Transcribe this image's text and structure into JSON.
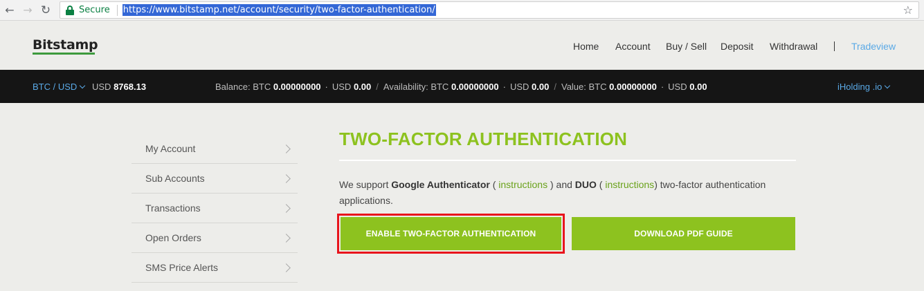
{
  "browser": {
    "secure_label": "Secure",
    "url": "https://www.bitstamp.net/account/security/two-factor-authentication/"
  },
  "header": {
    "logo": "Bitstamp",
    "nav": [
      "Home",
      "Account",
      "Buy / Sell",
      "Deposit",
      "Withdrawal"
    ],
    "tradeview": "Tradeview"
  },
  "ticker": {
    "pair": "BTC / USD",
    "price_currency": "USD",
    "price": "8768.13",
    "balance_label": "Balance:",
    "balance_btc_label": "BTC",
    "balance_btc": "0.00000000",
    "balance_usd_label": "USD",
    "balance_usd": "0.00",
    "availability_label": "Availability:",
    "availability_btc_label": "BTC",
    "availability_btc": "0.00000000",
    "availability_usd_label": "USD",
    "availability_usd": "0.00",
    "value_label": "Value:",
    "value_btc_label": "BTC",
    "value_btc": "0.00000000",
    "value_usd_label": "USD",
    "value_usd": "0.00",
    "account_name": "iHolding .io"
  },
  "sidebar": {
    "items": [
      {
        "label": "My Account"
      },
      {
        "label": "Sub Accounts"
      },
      {
        "label": "Transactions"
      },
      {
        "label": "Open Orders"
      },
      {
        "label": "SMS Price Alerts"
      }
    ]
  },
  "main": {
    "title": "TWO-FACTOR AUTHENTICATION",
    "desc_part1": "We support ",
    "google": "Google Authenticator",
    "desc_part2": " ( ",
    "instructions1": "instructions",
    "desc_part3": " ) and ",
    "duo": "DUO",
    "desc_part4": " ( ",
    "instructions2": "instructions",
    "desc_part5": ") two-factor authentication applications.",
    "enable_button": "ENABLE TWO-FACTOR AUTHENTICATION",
    "download_button": "DOWNLOAD PDF GUIDE"
  },
  "colors": {
    "accent_green": "#8dc21f",
    "link_blue": "#5aa9e6",
    "highlight_red": "#e8141c",
    "dark_bar": "#151515"
  }
}
